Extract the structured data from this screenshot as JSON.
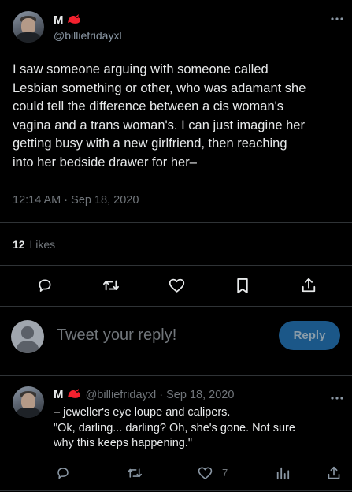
{
  "main_tweet": {
    "author_name": "M",
    "author_handle": "@billiefridayxl",
    "lines": [
      "I saw someone arguing with someone called",
      "Lesbian something or other, who was adamant she",
      "could tell the difference between a cis woman's",
      "vagina and a trans woman's. I can just imagine her",
      "getting busy with a new girlfriend, then reaching",
      "into her bedside drawer for her–"
    ],
    "timestamp": "12:14 AM · Sep 18, 2020",
    "likes_count": "12",
    "likes_label": "Likes"
  },
  "composer": {
    "placeholder": "Tweet your reply!",
    "reply_label": "Reply"
  },
  "reply_tweet": {
    "author_name": "M",
    "author_handle": "@billiefridayxl",
    "separator": "·",
    "date": "Sep 18, 2020",
    "lines": [
      "– jeweller's eye loupe and calipers.",
      "\"Ok, darling... darling? Oh, she's gone. Not sure",
      "why this keeps happening.\""
    ],
    "like_count": "7"
  },
  "icons": {
    "more": "more-icon",
    "badge": "red-bird-icon",
    "reply": "reply-icon",
    "retweet": "retweet-icon",
    "like": "heart-icon",
    "bookmark": "bookmark-icon",
    "share": "share-icon",
    "views": "analytics-icon"
  },
  "colors": {
    "background": "#000000",
    "text": "#e7e9ea",
    "muted": "#71767b",
    "accent": "#1b5788",
    "badge": "#f4212e"
  }
}
